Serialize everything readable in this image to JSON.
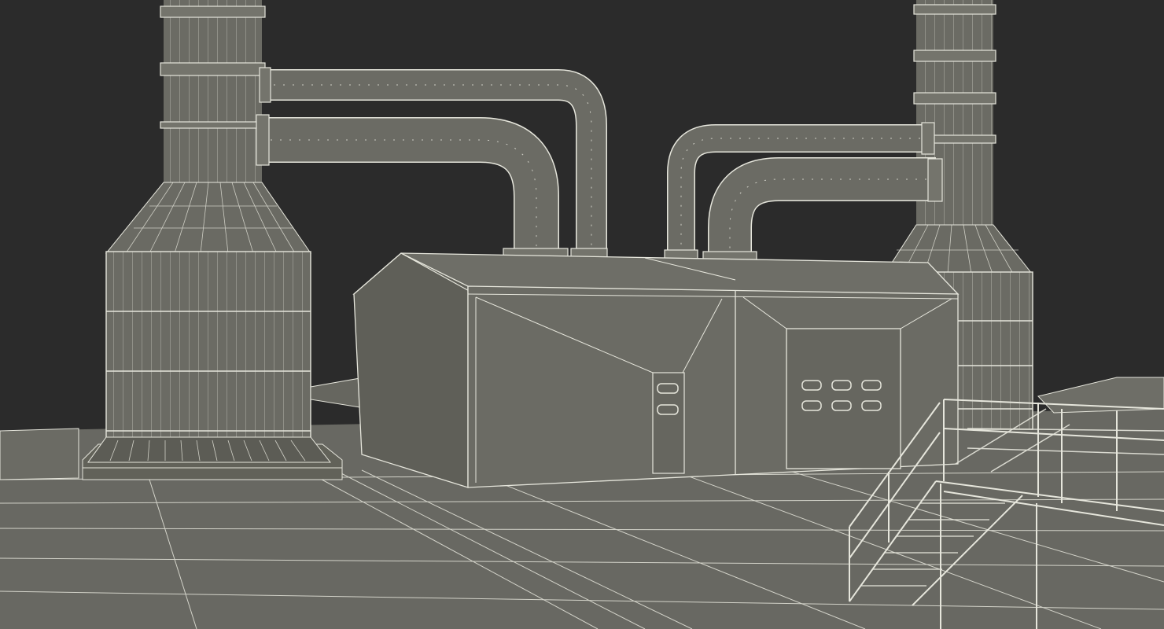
{
  "scene": {
    "subject": "wireframe-industrial-plant",
    "colors": {
      "background": "#2b2b2b",
      "surface": "#6b6b64",
      "surface_dark": "#55554f",
      "surface_light": "#7c7c74",
      "wire": "#e6e6dc",
      "ground": "#686862"
    }
  }
}
